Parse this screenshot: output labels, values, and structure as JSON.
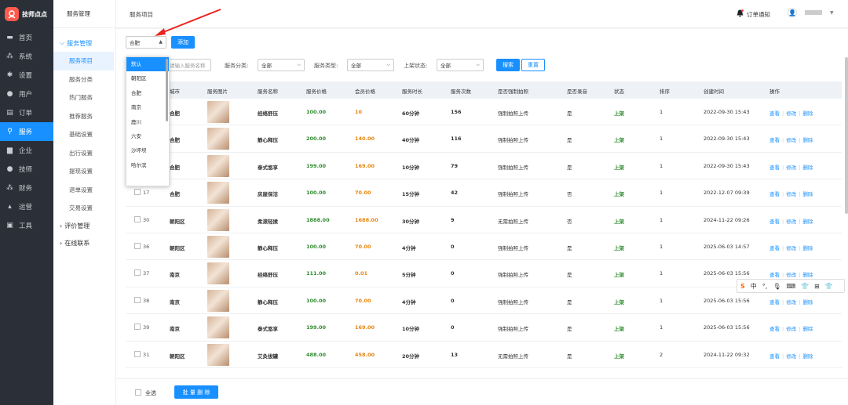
{
  "brand": {
    "name": "技师点点"
  },
  "sidebar": [
    {
      "label": "首页",
      "icon": "monitor-icon"
    },
    {
      "label": "系统",
      "icon": "sitemap-icon"
    },
    {
      "label": "设置",
      "icon": "gear-icon"
    },
    {
      "label": "用户",
      "icon": "user-icon"
    },
    {
      "label": "订单",
      "icon": "order-icon"
    },
    {
      "label": "服务",
      "icon": "link-icon"
    },
    {
      "label": "企业",
      "icon": "building-icon"
    },
    {
      "label": "技师",
      "icon": "technician-icon"
    },
    {
      "label": "财务",
      "icon": "finance-icon"
    },
    {
      "label": "运营",
      "icon": "chart-icon"
    },
    {
      "label": "工具",
      "icon": "toolbox-icon"
    }
  ],
  "submenu": {
    "header": "服务管理",
    "group": "服务管理",
    "items": [
      "服务项目",
      "服务分类",
      "热门服务",
      "推荐服务",
      "基础设置",
      "出行设置",
      "提现设置",
      "退单设置",
      "交易设置"
    ],
    "groups_closed": [
      "评价管理",
      "在线联系"
    ]
  },
  "topbar": {
    "breadcrumb": "服务项目",
    "notice": "订单通知"
  },
  "toolbar": {
    "city_value": "合肥",
    "add_label": "添加",
    "search_placeholder": "请输入服务名称",
    "category_label": "服务分类:",
    "type_label": "服务类型:",
    "status_label": "上架状态:",
    "all": "全部",
    "search_label": "搜索",
    "reset_label": "重置"
  },
  "dropdown": [
    "默认",
    "朝阳区",
    "合肥",
    "南京",
    "鹿川",
    "六安",
    "沙坪坝",
    "哈尔滨"
  ],
  "columns": [
    "城市",
    "服务图片",
    "服务名称",
    "服务价格",
    "会员价格",
    "服务时长",
    "服务次数",
    "是否强制拍照",
    "是否录音",
    "状态",
    "排序",
    "创建时间",
    "操作"
  ],
  "rows": [
    {
      "id": "",
      "city": "合肥",
      "name": "经络舒压",
      "price": "100.00",
      "member": "10",
      "dur": "60分钟",
      "count": "156",
      "photo": "强制拍照上传",
      "rec": "是",
      "status": "上架",
      "sort": "1",
      "time": "2022-09-30 15:43"
    },
    {
      "id": "",
      "city": "合肥",
      "name": "静心释压",
      "price": "200.00",
      "member": "140.00",
      "dur": "40分钟",
      "count": "116",
      "photo": "强制拍照上传",
      "rec": "是",
      "status": "上架",
      "sort": "1",
      "time": "2022-09-30 15:43"
    },
    {
      "id": "",
      "city": "合肥",
      "name": "泰式悠享",
      "price": "199.00",
      "member": "169.00",
      "dur": "10分钟",
      "count": "79",
      "photo": "强制拍照上传",
      "rec": "是",
      "status": "上架",
      "sort": "1",
      "time": "2022-09-30 15:43"
    },
    {
      "id": "17",
      "city": "合肥",
      "name": "房屋保洁",
      "price": "100.00",
      "member": "70.00",
      "dur": "15分钟",
      "count": "42",
      "photo": "强制拍照上传",
      "rec": "否",
      "status": "上架",
      "sort": "1",
      "time": "2022-12-07 09:39"
    },
    {
      "id": "30",
      "city": "朝阳区",
      "name": "柔滚轻揉",
      "price": "1888.00",
      "member": "1688.00",
      "dur": "30分钟",
      "count": "9",
      "photo": "无需拍照上传",
      "rec": "否",
      "status": "上架",
      "sort": "1",
      "time": "2024-11-22 09:26"
    },
    {
      "id": "36",
      "city": "朝阳区",
      "name": "静心释压",
      "price": "100.00",
      "member": "70.00",
      "dur": "4分钟",
      "count": "0",
      "photo": "强制拍照上传",
      "rec": "是",
      "status": "上架",
      "sort": "1",
      "time": "2025-06-03 14:57"
    },
    {
      "id": "37",
      "city": "南京",
      "name": "经络舒压",
      "price": "111.00",
      "member": "0.01",
      "dur": "5分钟",
      "count": "0",
      "photo": "强制拍照上传",
      "rec": "是",
      "status": "上架",
      "sort": "1",
      "time": "2025-06-03 15:56"
    },
    {
      "id": "38",
      "city": "南京",
      "name": "静心释压",
      "price": "100.00",
      "member": "70.00",
      "dur": "4分钟",
      "count": "0",
      "photo": "强制拍照上传",
      "rec": "是",
      "status": "上架",
      "sort": "1",
      "time": "2025-06-03 15:56"
    },
    {
      "id": "39",
      "city": "南京",
      "name": "泰式悠享",
      "price": "199.00",
      "member": "169.00",
      "dur": "10分钟",
      "count": "0",
      "photo": "强制拍照上传",
      "rec": "是",
      "status": "上架",
      "sort": "1",
      "time": "2025-06-03 15:56"
    },
    {
      "id": "31",
      "city": "朝阳区",
      "name": "艾灸拔罐",
      "price": "488.00",
      "member": "458.00",
      "dur": "20分钟",
      "count": "13",
      "photo": "无需拍照上传",
      "rec": "是",
      "status": "上架",
      "sort": "2",
      "time": "2024-11-22 09:32"
    }
  ],
  "ops": [
    "查看",
    "修改",
    "删除"
  ],
  "footer": {
    "select_all": "全选",
    "batch_delete": "批 量 删 除"
  },
  "ime": [
    "中",
    "°,",
    "🎙",
    "⌨",
    "👕",
    "⊞",
    "👕"
  ]
}
